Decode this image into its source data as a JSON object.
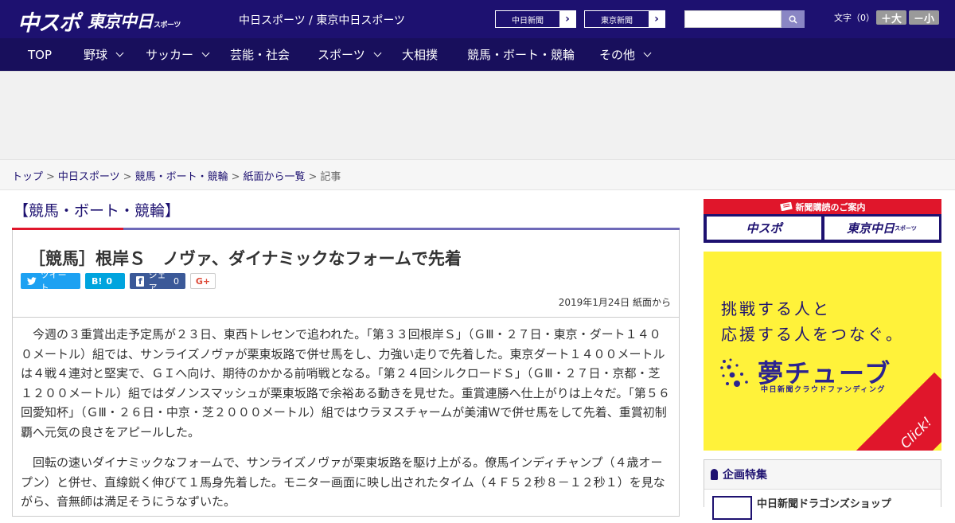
{
  "header": {
    "logo_chuspo": "中スポ",
    "logo_tokyo": "東京中日",
    "logo_tokyo_suffix": "スポーツ",
    "site_names": "中日スポーツ / 東京中日スポーツ",
    "link_chunichi": "中日新聞",
    "link_tokyo": "東京新聞",
    "search_placeholder": "",
    "font_size_label": "文字（0）",
    "font_bigger": "＋大",
    "font_smaller": "－小"
  },
  "nav": {
    "items": [
      {
        "label": "TOP"
      },
      {
        "label": "野球"
      },
      {
        "label": "サッカー"
      },
      {
        "label": "芸能・社会"
      },
      {
        "label": "スポーツ"
      },
      {
        "label": "大相撲"
      },
      {
        "label": "競馬・ボート・競輪"
      },
      {
        "label": "その他"
      }
    ]
  },
  "breadcrumb": {
    "items": [
      "トップ",
      "中日スポーツ",
      "競馬・ボート・競輪",
      "紙面から一覧"
    ],
    "current": "記事",
    "sep": ">"
  },
  "section": {
    "title": "【競馬・ボート・競輪】"
  },
  "article": {
    "headline": "［競馬］根岸Ｓ　ノヴァ、ダイナミックなフォームで先着",
    "share": {
      "twitter": "ツイート",
      "hatena_icon": "B!",
      "hatena_count": "0",
      "facebook": "シェア",
      "facebook_count": "0",
      "gplus": "G+"
    },
    "date": "2019年1月24日 紙面から",
    "paragraphs": [
      "今週の３重賞出走予定馬が２３日、東西トレセンで追われた。「第３３回根岸Ｓ」（ＧⅢ・２７日・東京・ダート１４００メートル）組では、サンライズノヴァが栗東坂路で併せ馬をし、力強い走りで先着した。東京ダート１４００メートルは４戦４連対と堅実で、ＧＩへ向け、期待のかかる前哨戦となる。「第２４回シルクロードＳ」（ＧⅢ・２７日・京都・芝１２００メートル）組ではダノンスマッシュが栗東坂路で余裕ある動きを見せた。重賞連勝へ仕上がりは上々だ。「第５６回愛知杯」（ＧⅢ・２６日・中京・芝２０００メートル）組ではウラヌスチャームが美浦Ｗで併せ馬をして先着、重賞初制覇へ元気の良さをアピールした。",
      "回転の速いダイナミックなフォームで、サンライズノヴァが栗東坂路を駆け上がる。僚馬インディチャンプ（４歳オープン）と併せ、直線鋭く伸びて１馬身先着した。モニター画面に映し出されたタイム（４Ｆ５２秒８－１２秒１）を見ながら、音無師は満足そうにうなずいた。"
    ]
  },
  "sidebar": {
    "subscribe_bar": "新聞購読のご案内",
    "sub_chuspo": "中スポ",
    "sub_tokyo": "東京中日",
    "sub_tokyo_suffix": "スポーツ",
    "yume_line1": "挑戦する人と",
    "yume_line2": "応援する人をつなぐ。",
    "yume_brand": "夢チューブ",
    "yume_sub": "中日新聞クラウドファンディング",
    "yume_click": "Click!",
    "special_title": "企画特集",
    "special_item": "中日新聞ドラゴンズショップ"
  },
  "colors": {
    "brand_navy": "#1d1170",
    "nav_navy": "#180f5c",
    "accent_red": "#e0162b",
    "banner_yellow": "#fff23a"
  }
}
